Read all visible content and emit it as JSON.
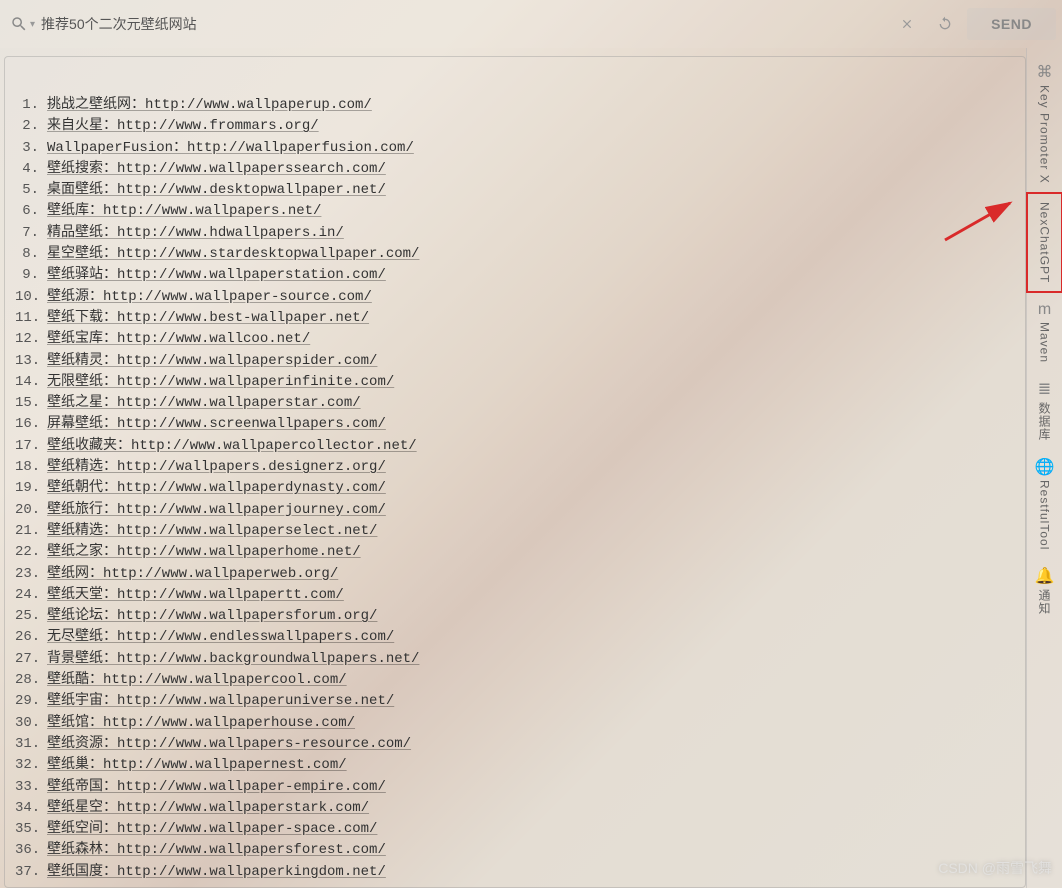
{
  "search": {
    "placeholder": "",
    "value": "推荐50个二次元壁纸网站"
  },
  "send_button_label": "SEND",
  "watermark": "CSDN @雨雪飞舞",
  "side_tabs": [
    {
      "icon": "⌘",
      "label": "Key Promoter X",
      "highlighted": false
    },
    {
      "icon": "",
      "label": "NexChatGPT",
      "highlighted": true
    },
    {
      "icon": "m",
      "label": "Maven",
      "highlighted": false
    },
    {
      "icon": "≣",
      "label": "数据库",
      "highlighted": false
    },
    {
      "icon": "🌐",
      "label": "RestfulTool",
      "highlighted": false
    },
    {
      "icon": "🔔",
      "label": "通知",
      "highlighted": false
    }
  ],
  "items": [
    {
      "n": 1,
      "text": "挑战之壁纸网：http://www.wallpaperup.com/"
    },
    {
      "n": 2,
      "text": "来自火星：http://www.frommars.org/"
    },
    {
      "n": 3,
      "text": "WallpaperFusion：http://wallpaperfusion.com/"
    },
    {
      "n": 4,
      "text": "壁纸搜索：http://www.wallpaperssearch.com/"
    },
    {
      "n": 5,
      "text": "桌面壁纸：http://www.desktopwallpaper.net/"
    },
    {
      "n": 6,
      "text": "壁纸库：http://www.wallpapers.net/"
    },
    {
      "n": 7,
      "text": "精品壁纸：http://www.hdwallpapers.in/"
    },
    {
      "n": 8,
      "text": "星空壁纸：http://www.stardesktopwallpaper.com/"
    },
    {
      "n": 9,
      "text": "壁纸驿站：http://www.wallpaperstation.com/"
    },
    {
      "n": 10,
      "text": "壁纸源：http://www.wallpaper-source.com/"
    },
    {
      "n": 11,
      "text": "壁纸下载：http://www.best-wallpaper.net/"
    },
    {
      "n": 12,
      "text": "壁纸宝库：http://www.wallcoo.net/"
    },
    {
      "n": 13,
      "text": "壁纸精灵：http://www.wallpaperspider.com/"
    },
    {
      "n": 14,
      "text": "无限壁纸：http://www.wallpaperinfinite.com/"
    },
    {
      "n": 15,
      "text": "壁纸之星：http://www.wallpaperstar.com/"
    },
    {
      "n": 16,
      "text": "屏幕壁纸：http://www.screenwallpapers.com/"
    },
    {
      "n": 17,
      "text": "壁纸收藏夹：http://www.wallpapercollector.net/"
    },
    {
      "n": 18,
      "text": "壁纸精选：http://wallpapers.designerz.org/"
    },
    {
      "n": 19,
      "text": "壁纸朝代：http://www.wallpaperdynasty.com/"
    },
    {
      "n": 20,
      "text": "壁纸旅行：http://www.wallpaperjourney.com/"
    },
    {
      "n": 21,
      "text": "壁纸精选：http://www.wallpaperselect.net/"
    },
    {
      "n": 22,
      "text": "壁纸之家：http://www.wallpaperhome.net/"
    },
    {
      "n": 23,
      "text": "壁纸网：http://www.wallpaperweb.org/"
    },
    {
      "n": 24,
      "text": "壁纸天堂：http://www.wallpapertt.com/"
    },
    {
      "n": 25,
      "text": "壁纸论坛：http://www.wallpapersforum.org/"
    },
    {
      "n": 26,
      "text": "无尽壁纸：http://www.endlesswallpapers.com/"
    },
    {
      "n": 27,
      "text": "背景壁纸：http://www.backgroundwallpapers.net/"
    },
    {
      "n": 28,
      "text": "壁纸酷：http://www.wallpapercool.com/"
    },
    {
      "n": 29,
      "text": "壁纸宇宙：http://www.wallpaperuniverse.net/"
    },
    {
      "n": 30,
      "text": "壁纸馆：http://www.wallpaperhouse.com/"
    },
    {
      "n": 31,
      "text": "壁纸资源：http://www.wallpapers-resource.com/"
    },
    {
      "n": 32,
      "text": "壁纸巢：http://www.wallpapernest.com/"
    },
    {
      "n": 33,
      "text": "壁纸帝国：http://www.wallpaper-empire.com/"
    },
    {
      "n": 34,
      "text": "壁纸星空：http://www.wallpaperstark.com/"
    },
    {
      "n": 35,
      "text": "壁纸空间：http://www.wallpaper-space.com/"
    },
    {
      "n": 36,
      "text": "壁纸森林：http://www.wallpapersforest.com/"
    },
    {
      "n": 37,
      "text": "壁纸国度：http://www.wallpaperkingdom.net/"
    }
  ]
}
